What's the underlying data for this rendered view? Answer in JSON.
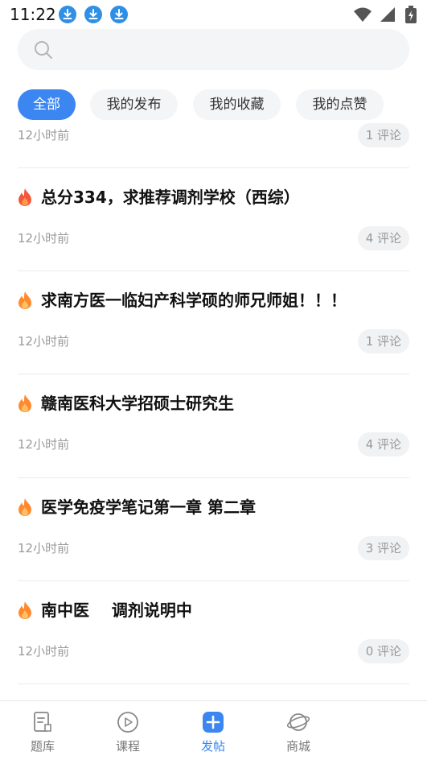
{
  "status_bar": {
    "time": "11:22"
  },
  "search": {
    "placeholder": ""
  },
  "tabs": [
    {
      "label": "全部",
      "active": true
    },
    {
      "label": "我的发布",
      "active": false
    },
    {
      "label": "我的收藏",
      "active": false
    },
    {
      "label": "我的点赞",
      "active": false
    }
  ],
  "posts": [
    {
      "title": "",
      "time": "12小时前",
      "comments": "1 评论"
    },
    {
      "title": "总分334，求推荐调剂学校（西综）",
      "time": "12小时前",
      "comments": "4 评论"
    },
    {
      "title": "求南方医一临妇产科学硕的师兄师姐！！！",
      "time": "12小时前",
      "comments": "1 评论"
    },
    {
      "title": "赣南医科大学招硕士研究生",
      "time": "12小时前",
      "comments": "4 评论"
    },
    {
      "title": "医学免疫学笔记第一章 第二章",
      "time": "12小时前",
      "comments": "3 评论"
    },
    {
      "title": "南中医    调剂说明中",
      "time": "12小时前",
      "comments": "0 评论"
    }
  ],
  "bottom_nav": [
    {
      "label": "题库",
      "icon": "question-bank-icon",
      "active": false
    },
    {
      "label": "课程",
      "icon": "play-course-icon",
      "active": false
    },
    {
      "label": "发帖",
      "icon": "post-plus-icon",
      "active": true
    },
    {
      "label": "商城",
      "icon": "planet-mall-icon",
      "active": false
    }
  ],
  "colors": {
    "accent": "#3b86f0",
    "flame": "#ff7a2e",
    "download_badge": "#2f8fe6"
  }
}
